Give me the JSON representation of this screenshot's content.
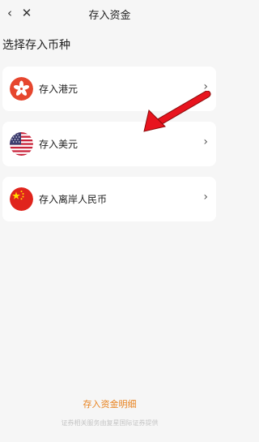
{
  "nav": {
    "back_icon": "chevron-left-icon",
    "close_icon": "close-icon",
    "title": "存入资金"
  },
  "section_title": "选择存入币种",
  "currencies": [
    {
      "label": "存入港元",
      "icon": "hk-flag-icon"
    },
    {
      "label": "存入美元",
      "icon": "us-flag-icon"
    },
    {
      "label": "存入离岸人民币",
      "icon": "cn-flag-icon"
    }
  ],
  "details_link": "存入资金明细",
  "footer": "证券相关服务由复星国际证券提供",
  "colors": {
    "accent": "#e8821e",
    "annotation_arrow": "#e8141e"
  }
}
